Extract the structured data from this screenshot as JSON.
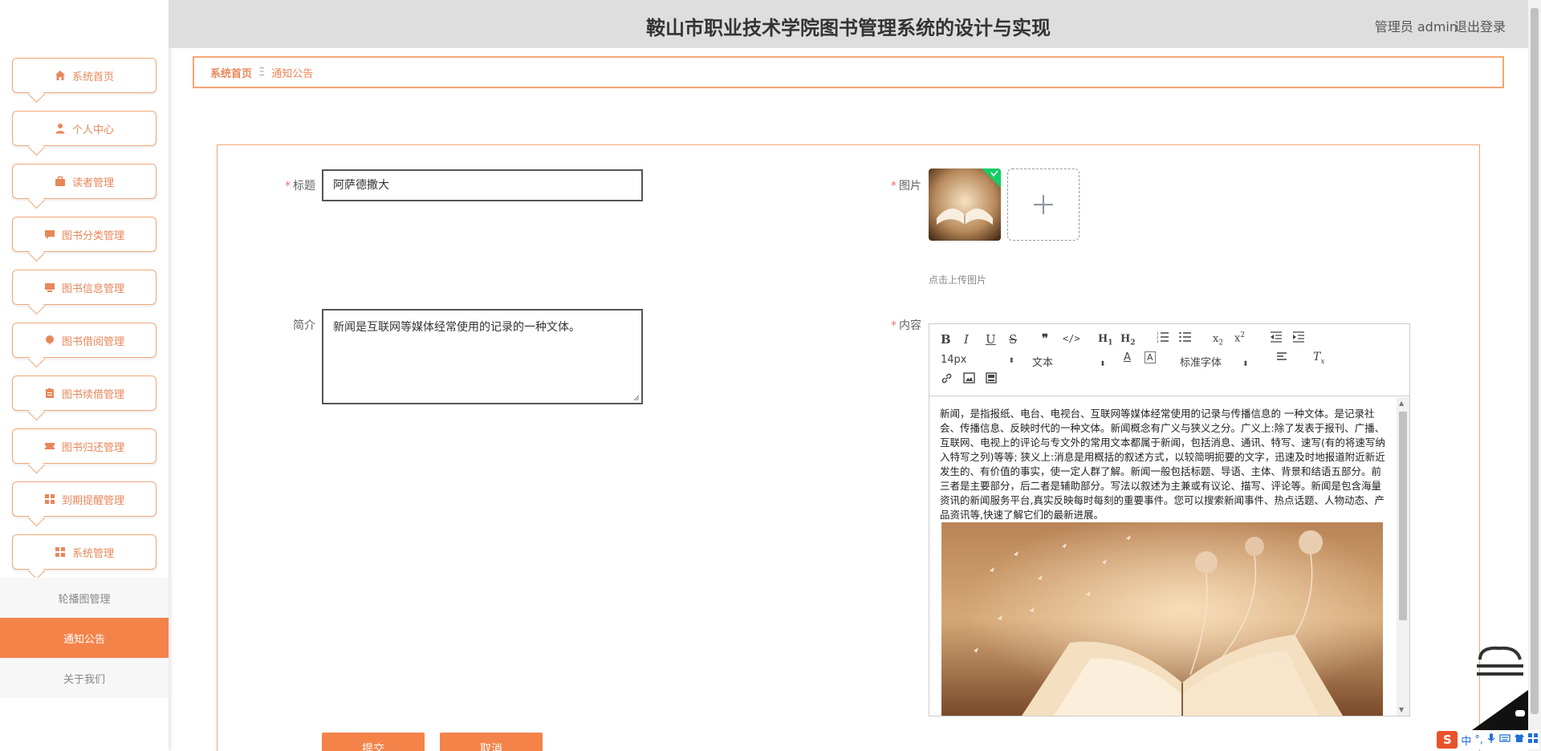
{
  "app": {
    "title": "鞍山市职业技术学院图书管理系统的设计与实现",
    "user_label": "管理员 admin",
    "logout_label": "退出登录"
  },
  "sidebar": {
    "items": [
      {
        "label": "系统首页",
        "icon": "home-icon"
      },
      {
        "label": "个人中心",
        "icon": "user-icon"
      },
      {
        "label": "读者管理",
        "icon": "briefcase-icon"
      },
      {
        "label": "图书分类管理",
        "icon": "chat-icon"
      },
      {
        "label": "图书信息管理",
        "icon": "monitor-icon"
      },
      {
        "label": "图书借阅管理",
        "icon": "balloon-icon"
      },
      {
        "label": "图书续借管理",
        "icon": "clipboard-icon"
      },
      {
        "label": "图书归还管理",
        "icon": "ticket-icon"
      },
      {
        "label": "到期提醒管理",
        "icon": "grid-icon"
      },
      {
        "label": "系统管理",
        "icon": "grid-icon"
      }
    ],
    "submenu": [
      {
        "label": "轮播图管理",
        "active": false
      },
      {
        "label": "通知公告",
        "active": true
      },
      {
        "label": "关于我们",
        "active": false
      }
    ]
  },
  "breadcrumb": {
    "home": "系统首页",
    "separator": "Ξ",
    "current": "通知公告"
  },
  "form": {
    "title_label": "标题",
    "title_value": "阿萨德撒大",
    "intro_label": "简介",
    "intro_value": "新闻是互联网等媒体经常使用的记录的一种文体。",
    "image_label": "图片",
    "upload_hint": "点击上传图片",
    "content_label": "内容",
    "submit_label": "提交",
    "cancel_label": "取消"
  },
  "editor": {
    "font_size": "14px",
    "paragraph": "文本",
    "font_family": "标准字体",
    "content_text": "新闻，是指报纸、电台、电视台、互联网等媒体经常使用的记录与传播信息的 一种文体。是记录社会、传播信息、反映时代的一种文体。新闻概念有广义与狭义之分。广义上:除了发表于报刊、广播、互联网、电视上的评论与专文外的常用文本都属于新闻，包括消息、通讯、特写、速写(有的将速写纳入特写之列)等等; 狭义上:消息是用概括的叙述方式，以较简明扼要的文字，迅速及时地报道附近新近发生的、有价值的事实，使一定人群了解。新闻一般包括标题、导语、主体、背景和结语五部分。前三者是主要部分，后二者是辅助部分。写法以叙述为主兼或有议论、描写、评论等。新闻是包含海量资讯的新闻服务平台,真实反映每时每刻的重要事件。您可以搜索新闻事件、热点话题、人物动态、产品资讯等,快速了解它们的最新进展。"
  },
  "ime": {
    "logo": "S",
    "lang": "中",
    "punct": "°,"
  },
  "colors": {
    "accent": "#f4834a",
    "accent_text": "#e8875a",
    "border": "#f4a574"
  }
}
